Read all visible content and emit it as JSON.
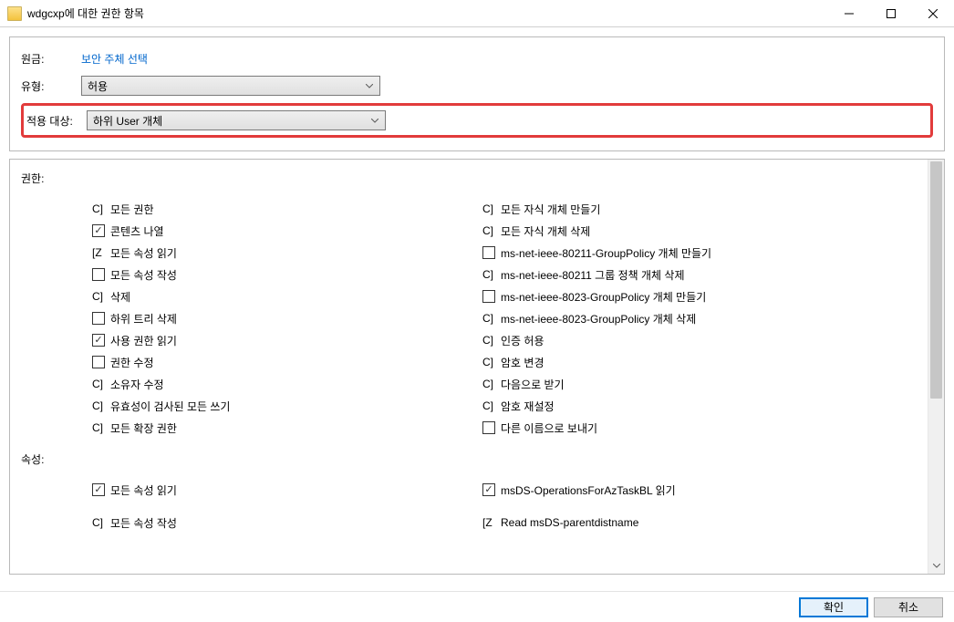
{
  "title": "wdgcxp에 대한 권한 항목",
  "form": {
    "principal_label": "원금:",
    "principal_value": "보안 주체 선택",
    "type_label": "유형:",
    "type_value": "허용",
    "applies_label": "적용 대상:",
    "applies_value": "하위 User 개체"
  },
  "sections": {
    "permissions": "권한:",
    "properties": "속성:"
  },
  "permissions_left": [
    {
      "kind": "marker",
      "prefix": "C]",
      "label": "모든 권한"
    },
    {
      "kind": "check",
      "checked": true,
      "label": "콘텐츠 나열"
    },
    {
      "kind": "marker",
      "prefix": "[Z",
      "label": "모든 속성 읽기"
    },
    {
      "kind": "check",
      "checked": false,
      "label": "모든 속성 작성"
    },
    {
      "kind": "marker",
      "prefix": "C]",
      "label": "삭제"
    },
    {
      "kind": "check",
      "checked": false,
      "label": "하위 트리 삭제"
    },
    {
      "kind": "check",
      "checked": true,
      "label": "사용 권한 읽기"
    },
    {
      "kind": "check",
      "checked": false,
      "label": "권한 수정"
    },
    {
      "kind": "marker",
      "prefix": "C]",
      "label": "소유자 수정"
    },
    {
      "kind": "marker",
      "prefix": "C]",
      "label": "유효성이 검사된 모든 쓰기"
    },
    {
      "kind": "marker",
      "prefix": "C]",
      "label": "모든 확장 권한"
    }
  ],
  "permissions_right": [
    {
      "kind": "marker",
      "prefix": "C]",
      "label": "모든 자식 개체 만들기"
    },
    {
      "kind": "marker",
      "prefix": "C]",
      "label": "모든 자식 개체 삭제"
    },
    {
      "kind": "check",
      "checked": false,
      "label": "ms-net-ieee-80211-GroupPolicy 개체 만들기"
    },
    {
      "kind": "marker",
      "prefix": "C]",
      "label": "ms-net-ieee-80211 그룹 정책 개체 삭제"
    },
    {
      "kind": "check",
      "checked": false,
      "label": "ms-net-ieee-8023-GroupPolicy 개체 만들기"
    },
    {
      "kind": "marker",
      "prefix": "C]",
      "label": "ms-net-ieee-8023-GroupPolicy 개체 삭제"
    },
    {
      "kind": "marker",
      "prefix": "C]",
      "label": "인증 허용"
    },
    {
      "kind": "marker",
      "prefix": "C]",
      "label": "암호 변경"
    },
    {
      "kind": "marker",
      "prefix": "C]",
      "label": "다음으로 받기"
    },
    {
      "kind": "marker",
      "prefix": "C]",
      "label": "암호 재설정"
    },
    {
      "kind": "check",
      "checked": false,
      "label": "다른 이름으로 보내기"
    }
  ],
  "properties_left": [
    {
      "kind": "check",
      "checked": true,
      "label": "모든 속성 읽기"
    },
    {
      "kind": "spacer"
    },
    {
      "kind": "marker",
      "prefix": "C]",
      "label": "모든 속성 작성"
    }
  ],
  "properties_right": [
    {
      "kind": "check",
      "checked": true,
      "label": "msDS-OperationsForAzTaskBL 읽기"
    },
    {
      "kind": "spacer"
    },
    {
      "kind": "marker",
      "prefix": "[Z",
      "label": "Read msDS-parentdistname"
    }
  ],
  "buttons": {
    "ok": "확인",
    "cancel": "취소"
  }
}
